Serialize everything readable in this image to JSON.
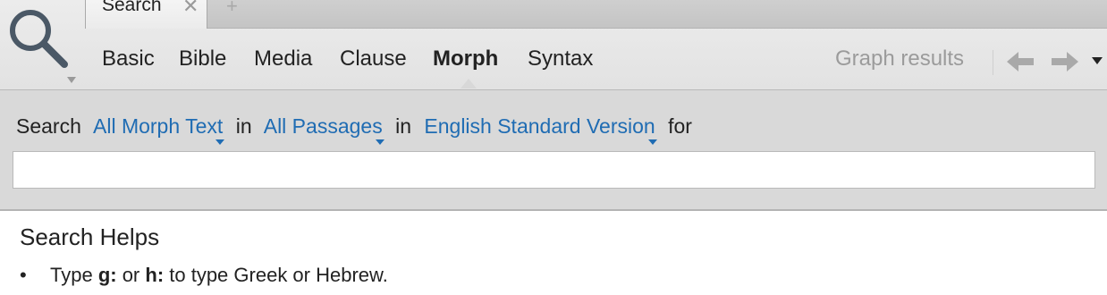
{
  "window_tab": {
    "title": "Search",
    "close_glyph": "✕",
    "new_tab_glyph": "+"
  },
  "icons": {
    "search": "search-icon",
    "search_menu": "chevron-down-icon",
    "back": "arrow-left-icon",
    "forward": "arrow-right-icon",
    "panel_menu": "triangle-down-icon"
  },
  "nav_tabs": [
    {
      "label": "Basic"
    },
    {
      "label": "Bible"
    },
    {
      "label": "Media"
    },
    {
      "label": "Clause"
    },
    {
      "label": "Morph",
      "active": true
    },
    {
      "label": "Syntax"
    }
  ],
  "toolbar": {
    "graph_results_label": "Graph results"
  },
  "query": {
    "search_word": "Search",
    "scope_link": "All Morph Text",
    "in_word_1": "in",
    "range_link": "All Passages",
    "in_word_2": "in",
    "version_link": "English Standard Version",
    "for_word": "for",
    "input_value": "",
    "input_placeholder": ""
  },
  "search_helps": {
    "title": "Search Helps",
    "item_1": {
      "bullet": "•",
      "prefix": "Type ",
      "key1": "g:",
      "middle": " or ",
      "key2": "h:",
      "suffix": " to type Greek or Hebrew."
    }
  },
  "colors": {
    "link": "#1f6cb3",
    "header_bg": "#e6e6e6",
    "query_bg": "#d9d9d9",
    "disabled_text": "#9b9b9b",
    "icon": "#4a5866"
  }
}
